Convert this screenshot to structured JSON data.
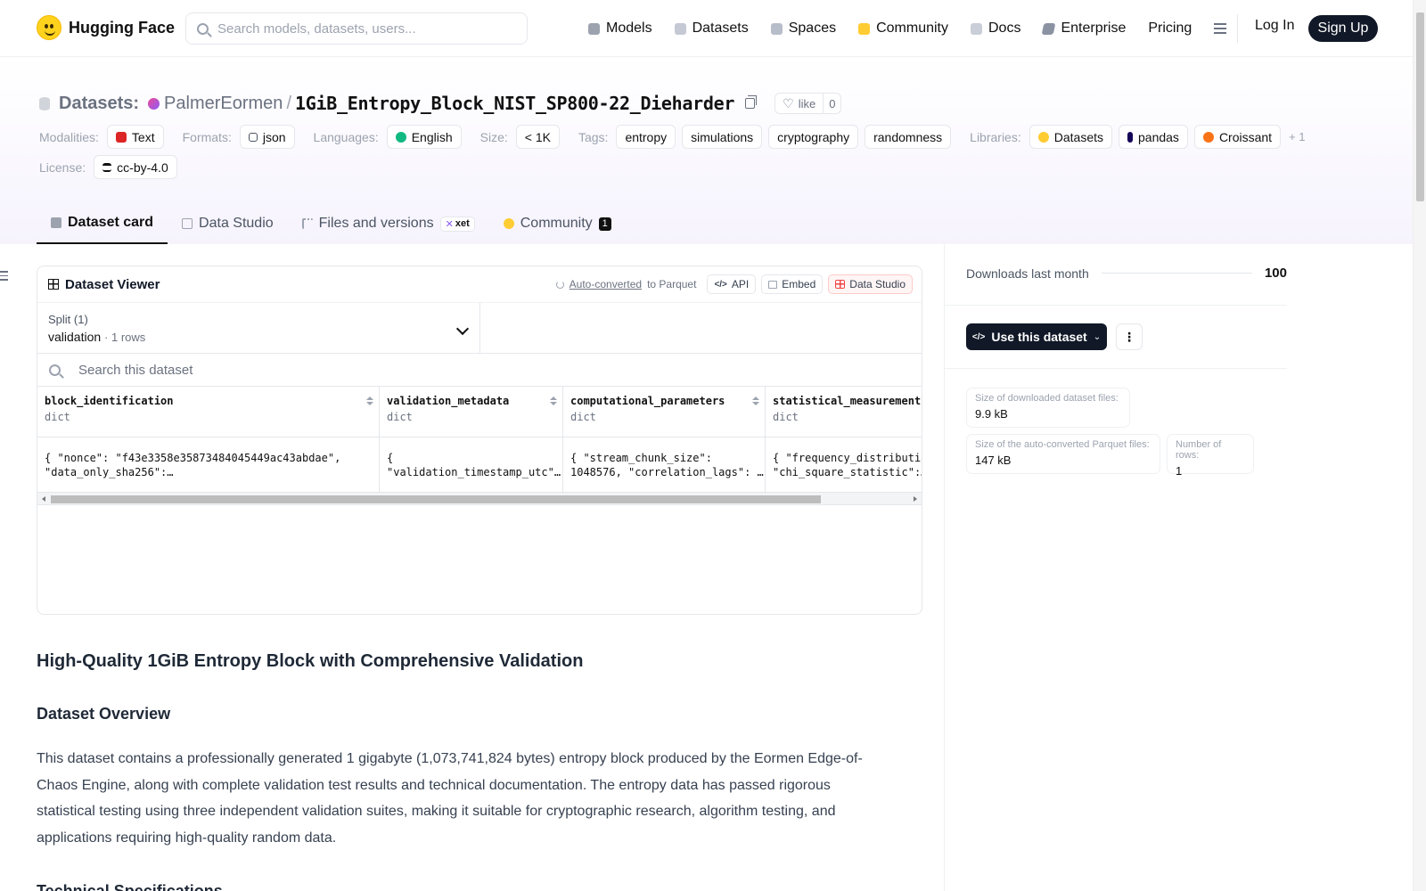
{
  "nav": {
    "brand": "Hugging Face",
    "search_placeholder": "Search models, datasets, users...",
    "links": [
      "Models",
      "Datasets",
      "Spaces",
      "Community",
      "Docs",
      "Enterprise",
      "Pricing"
    ],
    "login": "Log In",
    "signup": "Sign Up"
  },
  "repo": {
    "type_label": "Datasets:",
    "owner": "PalmerEormen",
    "separator": "/",
    "name": "1GiB_Entropy_Block_NIST_SP800-22_Dieharder",
    "like_label": "like",
    "like_count": "0"
  },
  "meta": {
    "modalities_label": "Modalities:",
    "modalities": [
      "Text"
    ],
    "formats_label": "Formats:",
    "formats": [
      "json"
    ],
    "languages_label": "Languages:",
    "languages": [
      "English"
    ],
    "size_label": "Size:",
    "size": "< 1K",
    "tags_label": "Tags:",
    "tags": [
      "entropy",
      "simulations",
      "cryptography",
      "randomness"
    ],
    "libraries_label": "Libraries:",
    "libraries": [
      "Datasets",
      "pandas",
      "Croissant"
    ],
    "libraries_more": "+ 1",
    "license_label": "License:",
    "license": "cc-by-4.0"
  },
  "tabs": [
    {
      "label": "Dataset card",
      "active": true
    },
    {
      "label": "Data Studio"
    },
    {
      "label": "Files and versions",
      "badge": "xet"
    },
    {
      "label": "Community",
      "count": "1"
    }
  ],
  "viewer": {
    "title": "Dataset Viewer",
    "auto_converted": "Auto-converted",
    "to_parquet": "to Parquet",
    "api": "API",
    "embed": "Embed",
    "data_studio": "Data Studio",
    "split_label": "Split (1)",
    "split_value": "validation",
    "split_rows": "1 rows",
    "search_placeholder": "Search this dataset",
    "columns": [
      {
        "name": "block_identification",
        "type": "dict"
      },
      {
        "name": "validation_metadata",
        "type": "dict"
      },
      {
        "name": "computational_parameters",
        "type": "dict"
      },
      {
        "name": "statistical_measurements",
        "type": "dict"
      }
    ],
    "rows": [
      [
        "{ \"nonce\": \"f43e3358e35873484045449ac43abdae\",\n\"data_only_sha256\":…",
        "{\n\"validation_timestamp_utc\"…",
        "{ \"stream_chunk_size\":\n1048576, \"correlation_lags\": …",
        "{ \"frequency_distributio\n\"chi_square_statistic\":…"
      ]
    ]
  },
  "card": {
    "h1": "High-Quality 1GiB Entropy Block with Comprehensive Validation",
    "h2_overview": "Dataset Overview",
    "overview_text": "This dataset contains a professionally generated 1 gigabyte (1,073,741,824 bytes) entropy block produced by the Eormen Edge-of-Chaos Engine, along with complete validation test results and technical documentation. The entropy data has passed rigorous statistical testing using three independent validation suites, making it suitable for cryptographic research, algorithm testing, and applications requiring high-quality random data.",
    "h2_tech": "Technical Specifications"
  },
  "sidebar": {
    "downloads_label": "Downloads last month",
    "downloads_value": "100",
    "use_dataset": "Use this dataset",
    "more": "⋮",
    "download_size_label": "Size of downloaded dataset files:",
    "download_size": "9.9 kB",
    "parquet_size_label": "Size of the auto-converted Parquet files:",
    "parquet_size": "147 kB",
    "num_rows_label": "Number of rows:",
    "num_rows": "1"
  },
  "colors": {
    "accent_dark": "#111827",
    "header_tint": "#f6f3fd",
    "brand_yellow": "#ffd21e"
  }
}
